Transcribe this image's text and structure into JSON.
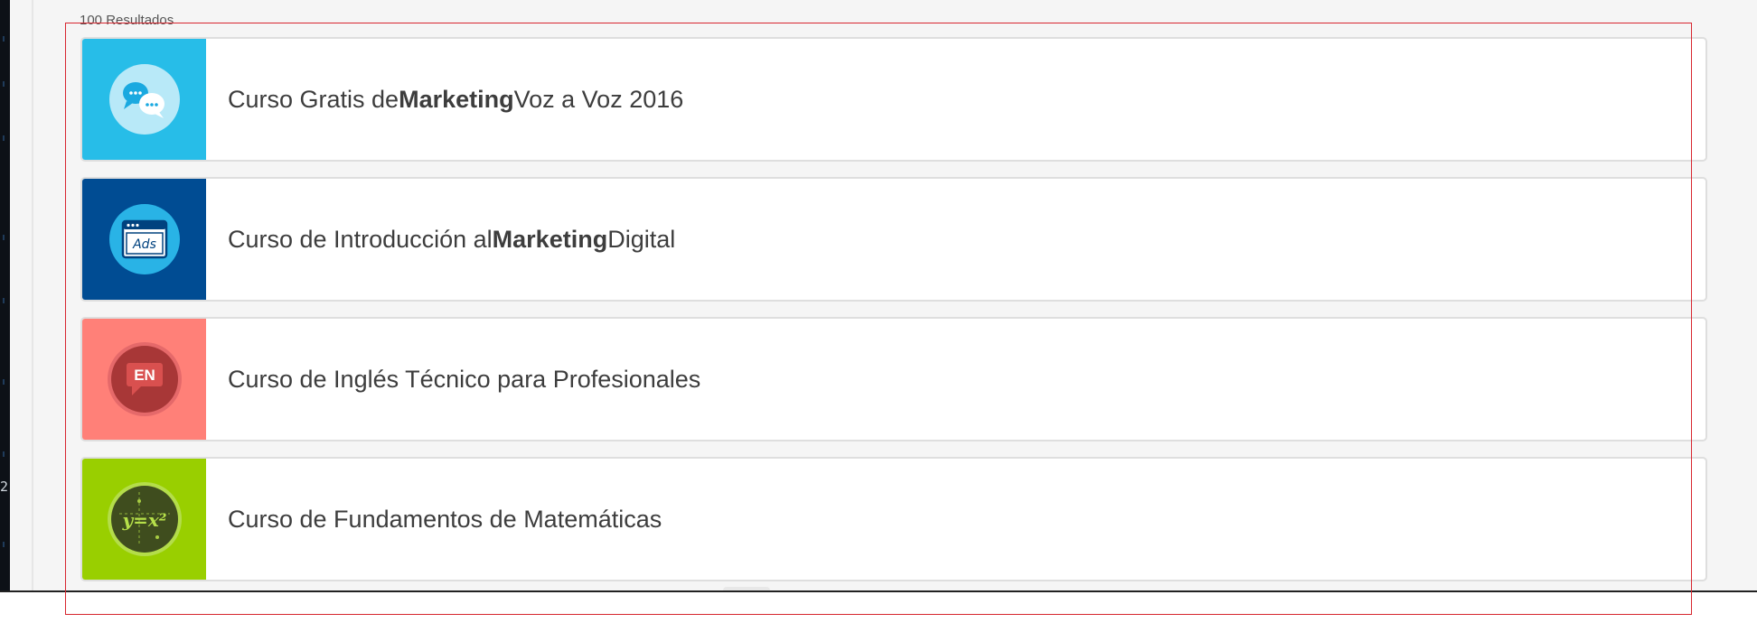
{
  "results": {
    "count_label": "100 Resultados"
  },
  "left_strip": {
    "line_number": "2"
  },
  "courses": [
    {
      "pre": "Curso Gratis de ",
      "bold": "Marketing",
      "post": " Voz a Voz 2016",
      "icon": "chat-bubbles-icon",
      "thumb_bg": "#27bde8"
    },
    {
      "pre": "Curso de Introducción al ",
      "bold": "Marketing",
      "post": " Digital",
      "icon": "ads-window-icon",
      "icon_text": "Ads",
      "thumb_bg": "#004c93"
    },
    {
      "pre": "Curso de Inglés Técnico para Profesionales",
      "bold": "",
      "post": "",
      "icon": "english-speech-icon",
      "icon_text": "EN",
      "thumb_bg": "#ff8078"
    },
    {
      "pre": "Curso de Fundamentos de Matemáticas",
      "bold": "",
      "post": "",
      "icon": "math-formula-icon",
      "icon_text": "y=x²",
      "thumb_bg": "#99cf00"
    }
  ],
  "colors": {
    "page_background": "#f5f5f5",
    "selection_outline": "#d7262f",
    "title_text": "#3d3d3d"
  }
}
